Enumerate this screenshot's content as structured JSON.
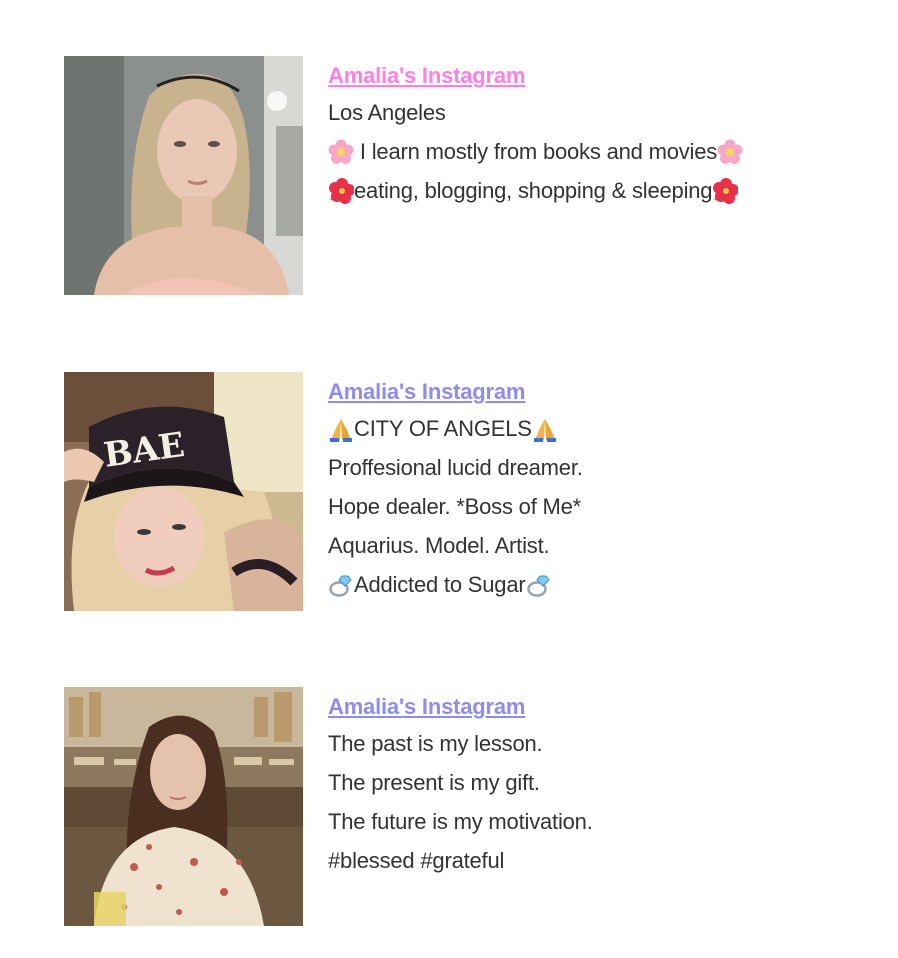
{
  "colors": {
    "link_pink": "#ff7fe6",
    "link_purple": "#8f8cf0",
    "text": "#333333",
    "background": "#ffffff"
  },
  "profiles": [
    {
      "link_label": "Amalia's Instagram",
      "link_color": "#ff7fe6",
      "photo_icon": "portrait-photo",
      "lines": [
        {
          "pre_icon": "",
          "text": "Los Angeles",
          "post_icon": ""
        },
        {
          "pre_icon": "cherry-blossom-emoji",
          "text": " I learn mostly from books and movies",
          "post_icon": "cherry-blossom-emoji"
        },
        {
          "pre_icon": "hibiscus-emoji",
          "text": "eating, blogging, shopping & sleeping",
          "post_icon": "hibiscus-emoji"
        }
      ]
    },
    {
      "link_label": "Amalia's Instagram",
      "link_color": "#8f8cf0",
      "photo_icon": "portrait-photo-cap",
      "photo_cap_text": "BAE",
      "lines": [
        {
          "pre_icon": "folded-hands-emoji",
          "text": "CITY OF ANGELS",
          "post_icon": "folded-hands-emoji"
        },
        {
          "pre_icon": "",
          "text": "Proffesional lucid dreamer.",
          "post_icon": ""
        },
        {
          "pre_icon": "",
          "text": "Hope dealer. *Boss of Me*",
          "post_icon": ""
        },
        {
          "pre_icon": "",
          "text": "Aquarius. Model. Artist.",
          "post_icon": ""
        },
        {
          "pre_icon": "ring-emoji",
          "text": "Addicted to Sugar",
          "post_icon": "ring-emoji"
        }
      ]
    },
    {
      "link_label": "Amalia's Instagram",
      "link_color": "#8f8cf0",
      "photo_icon": "portrait-photo-cafe",
      "lines": [
        {
          "pre_icon": "",
          "text": "The past is my lesson.",
          "post_icon": ""
        },
        {
          "pre_icon": "",
          "text": "The present is my gift.",
          "post_icon": ""
        },
        {
          "pre_icon": "",
          "text": "The future is my motivation.",
          "post_icon": ""
        },
        {
          "pre_icon": "",
          "text": "#blessed #grateful",
          "post_icon": ""
        }
      ]
    }
  ]
}
